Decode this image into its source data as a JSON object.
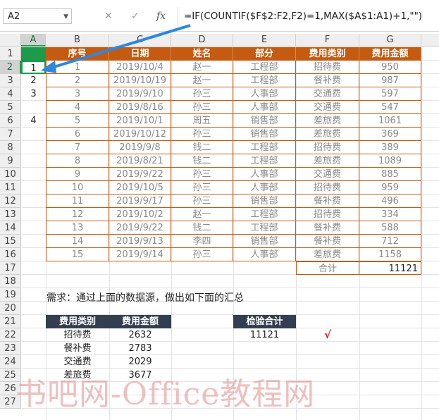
{
  "formula_bar": {
    "name_box": "A2",
    "cancel_icon": "✕",
    "enter_icon": "✓",
    "fx_label": "fx",
    "formula": "=IF(COUNTIF($F$2:F2,F2)=1,MAX($A$1:A1)+1,\"\")"
  },
  "columns": [
    "A",
    "B",
    "C",
    "D",
    "E",
    "F",
    "G"
  ],
  "rows": [
    "1",
    "2",
    "3",
    "4",
    "5",
    "6",
    "7",
    "8",
    "9",
    "10",
    "11",
    "12",
    "13",
    "14",
    "15",
    "16",
    "17",
    "18",
    "19",
    "20",
    "21",
    "22",
    "23",
    "24",
    "25",
    "26",
    "27"
  ],
  "table_header": [
    "序号",
    "日期",
    "姓名",
    "部分",
    "费用类别",
    "费用金额"
  ],
  "col_a_values": [
    "1",
    "2",
    "3",
    "",
    "4",
    "",
    "",
    "",
    "",
    "",
    "",
    "",
    "",
    "",
    ""
  ],
  "table_rows": [
    [
      "1",
      "2019/10/4",
      "赵一",
      "工程部",
      "招待费",
      "950"
    ],
    [
      "2",
      "2019/10/19",
      "赵一",
      "工程部",
      "餐补费",
      "987"
    ],
    [
      "3",
      "2019/9/10",
      "孙三",
      "人事部",
      "交通费",
      "597"
    ],
    [
      "4",
      "2019/8/16",
      "孙三",
      "人事部",
      "交通费",
      "547"
    ],
    [
      "5",
      "2019/10/1",
      "周五",
      "销售部",
      "差旅费",
      "1061"
    ],
    [
      "6",
      "2019/10/12",
      "孙三",
      "销售部",
      "差旅费",
      "369"
    ],
    [
      "7",
      "2019/9/8",
      "钱二",
      "工程部",
      "招待费",
      "389"
    ],
    [
      "8",
      "2019/8/21",
      "钱二",
      "工程部",
      "差旅费",
      "1089"
    ],
    [
      "9",
      "2019/9/22",
      "孙三",
      "人事部",
      "交通费",
      "885"
    ],
    [
      "10",
      "2019/10/5",
      "孙三",
      "人事部",
      "招待费",
      "959"
    ],
    [
      "11",
      "2019/9/17",
      "孙三",
      "销售部",
      "餐补费",
      "496"
    ],
    [
      "12",
      "2019/10/2",
      "赵一",
      "工程部",
      "招待费",
      "334"
    ],
    [
      "13",
      "2019/9/22",
      "钱二",
      "工程部",
      "餐补费",
      "588"
    ],
    [
      "14",
      "2019/9/13",
      "李四",
      "销售部",
      "餐补费",
      "712"
    ],
    [
      "15",
      "2019/9/14",
      "孙三",
      "人事部",
      "差旅费",
      "1158"
    ]
  ],
  "total": {
    "label": "合计",
    "value": "11121"
  },
  "requirement": "需求：通过上面的数据源，做出如下面的汇总",
  "summary": {
    "headers": [
      "费用类别",
      "费用金额"
    ],
    "rows": [
      [
        "招待费",
        "2632"
      ],
      [
        "餐补费",
        "2783"
      ],
      [
        "交通费",
        "2029"
      ],
      [
        "差旅费",
        "3677"
      ]
    ]
  },
  "check": {
    "header": "检验合计",
    "value": "11121",
    "mark": "√"
  },
  "watermark": "书吧网-Office教程网",
  "colors": {
    "header_fill": "#c55a11",
    "summary_header_fill": "#333f50",
    "selected_col": "#1e9b4a",
    "arrow": "#2e86de",
    "check": "#e02020"
  }
}
